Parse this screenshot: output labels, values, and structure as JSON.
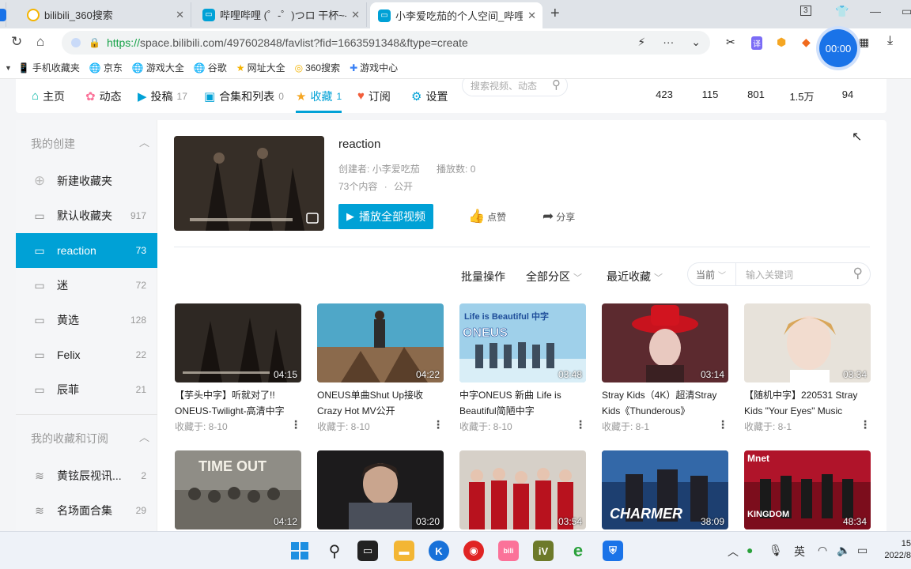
{
  "browser": {
    "tabs": [
      {
        "title": "bilibili_360搜索",
        "icon": "360-search-icon"
      },
      {
        "title": "哔哩哔哩 (゜-゜)つロ 干杯~-b",
        "icon": "bilibili-tv-icon"
      },
      {
        "title": "小李爱吃茄的个人空间_哔哩哔",
        "icon": "bilibili-tv-icon"
      }
    ],
    "tab_badge": "3",
    "url_https": "https://",
    "url_rest": "space.bilibili.com/497602848/favlist?fid=1663591348&ftype=create",
    "timer": "00:00"
  },
  "bookmarks": [
    {
      "label": "手机收藏夹",
      "icon": "phone-icon"
    },
    {
      "label": "京东",
      "icon": "globe-icon"
    },
    {
      "label": "游戏大全",
      "icon": "globe-icon"
    },
    {
      "label": "谷歌",
      "icon": "globe-icon"
    },
    {
      "label": "网址大全",
      "icon": "star-icon"
    },
    {
      "label": "360搜索",
      "icon": "360-search-icon"
    },
    {
      "label": "游戏中心",
      "icon": "gamepad-icon"
    }
  ],
  "nav": {
    "items": [
      {
        "label": "主页",
        "count": ""
      },
      {
        "label": "动态",
        "count": ""
      },
      {
        "label": "投稿",
        "count": "17"
      },
      {
        "label": "合集和列表",
        "count": "0"
      },
      {
        "label": "收藏",
        "count": "1"
      },
      {
        "label": "订阅",
        "count": ""
      },
      {
        "label": "设置",
        "count": ""
      }
    ],
    "search_placeholder": "搜索视频、动态",
    "stats": [
      "423",
      "115",
      "801",
      "1.5万",
      "94"
    ]
  },
  "sidebar": {
    "created_header": "我的创建",
    "new_folder": "新建收藏夹",
    "folders": [
      {
        "label": "默认收藏夹",
        "count": "917"
      },
      {
        "label": "reaction",
        "count": "73"
      },
      {
        "label": "迷",
        "count": "72"
      },
      {
        "label": "黄选",
        "count": "128"
      },
      {
        "label": "Felix",
        "count": "22"
      },
      {
        "label": "辰菲",
        "count": "21"
      }
    ],
    "subscribed_header": "我的收藏和订阅",
    "subscribed": [
      {
        "label": "黄铉辰视讯...",
        "count": "2"
      },
      {
        "label": "名场面合集",
        "count": "29"
      }
    ]
  },
  "favlist": {
    "title": "reaction",
    "creator_label": "创建者:",
    "creator": "小李爱吃茄",
    "plays_label": "播放数:",
    "plays": "0",
    "count_text": "73个内容",
    "visibility": "公开",
    "play_all": "播放全部视频",
    "like": "点赞",
    "share": "分享"
  },
  "filters": {
    "batch": "批量操作",
    "category": "全部分区",
    "sort": "最近收藏",
    "scope": "当前",
    "keyword_placeholder": "输入关键词"
  },
  "videos": [
    {
      "title": "【芋头中字】听就对了!! ONEUS-Twilight-高清中字",
      "duration": "04:15",
      "fav_date": "收藏于:   8-10"
    },
    {
      "title": "ONEUS单曲Shut Up接收Crazy Hot MV公开",
      "duration": "04:22",
      "fav_date": "收藏于:   8-10"
    },
    {
      "title": "中字ONEUS 新曲 Life is Beautiful简陋中字",
      "duration": "03:48",
      "fav_date": "收藏于:   8-10"
    },
    {
      "title": "Stray Kids（4K）超清Stray Kids《Thunderous》",
      "duration": "03:14",
      "fav_date": "收藏于:   8-1"
    },
    {
      "title": "【随机中字】220531 Stray Kids \"Your Eyes\" Music",
      "duration": "03:34",
      "fav_date": "收藏于:   8-1"
    },
    {
      "title": "",
      "duration": "04:12",
      "fav_date": ""
    },
    {
      "title": "",
      "duration": "03:20",
      "fav_date": ""
    },
    {
      "title": "",
      "duration": "03:54",
      "fav_date": ""
    },
    {
      "title": "",
      "duration": "38:09",
      "fav_date": ""
    },
    {
      "title": "",
      "duration": "48:34",
      "fav_date": ""
    }
  ],
  "thumb_text": {
    "t2": "Life is Beautiful 中字",
    "t2b": "ONEUS",
    "t5": "TIME OUT",
    "t8": "CHARMER",
    "t9a": "Mnet",
    "t9b": "KINGDOM"
  },
  "taskbar": {
    "ime": "英",
    "time": "15",
    "date": "2022/8"
  },
  "colors": {
    "accent": "#00a1d6"
  }
}
